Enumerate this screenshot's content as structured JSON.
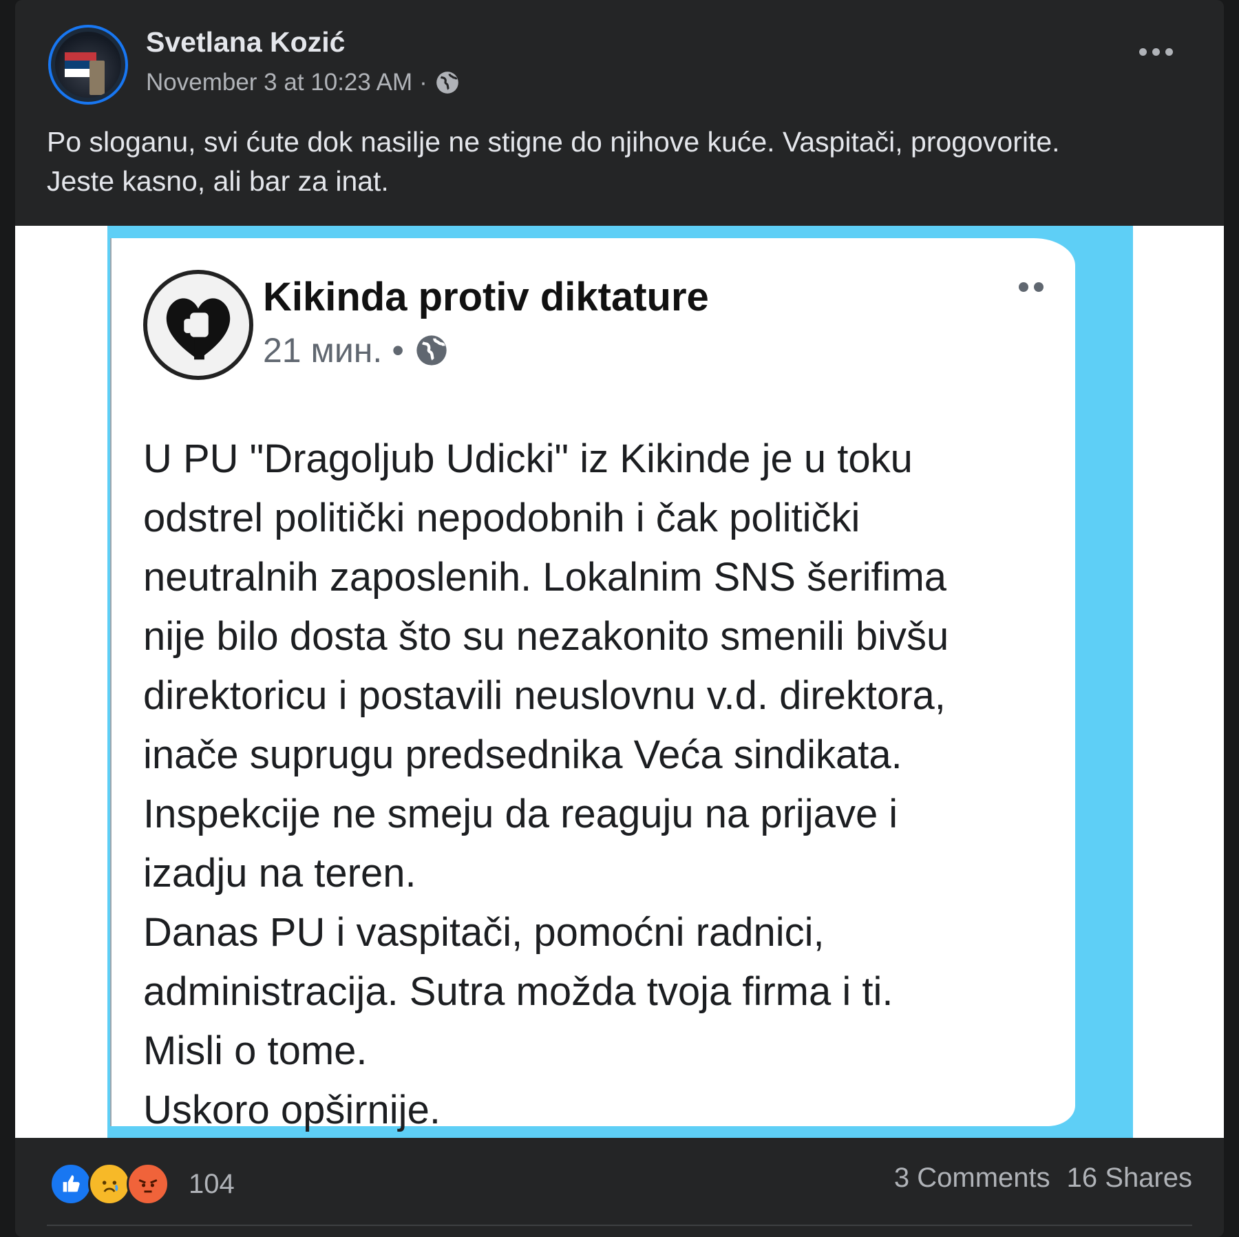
{
  "post": {
    "author": "Svetlana Kozić",
    "timestamp": "November 3 at 10:23 AM",
    "separator": "·",
    "audience_icon": "globe-icon",
    "caption_line1": "Po sloganu, svi ćute dok nasilje ne stigne do njihove kuće. Vaspitači, progovorite.",
    "caption_line2": "Jeste kasno, ali bar za inat."
  },
  "shared_screenshot": {
    "page_name": "Kikinda protiv diktature",
    "time": "21 мин.",
    "separator": "•",
    "lines": [
      "U PU \"Dragoljub Udicki\" iz Kikinde je u toku",
      "odstrel politički nepodobnih i čak politički",
      "neutralnih zaposlenih. Lokalnim SNS šerifima",
      "nije bilo dosta što su nezakonito smenili bivšu",
      "direktoricu i postavili neuslovnu v.d. direktora,",
      "inače suprugu predsednika Veća sindikata.",
      "Inspekcije ne smeju da reaguju na prijave i",
      "izadju na teren.",
      "Danas PU i vaspitači, pomoćni radnici,",
      "administracija. Sutra možda tvoja firma i ti.",
      "Misli o tome.",
      "Uskoro opširnije."
    ]
  },
  "footer": {
    "reaction_count": "104",
    "comments": "3 Comments",
    "shares": "16 Shares",
    "reaction_icons": [
      "like-icon",
      "sad-icon",
      "angry-icon"
    ]
  },
  "colors": {
    "background": "#18191a",
    "card": "#242526",
    "primary_text": "#e4e6eb",
    "secondary_text": "#b0b3b8",
    "accent": "#1877f2",
    "screenshot_frame": "#5ecff6"
  }
}
